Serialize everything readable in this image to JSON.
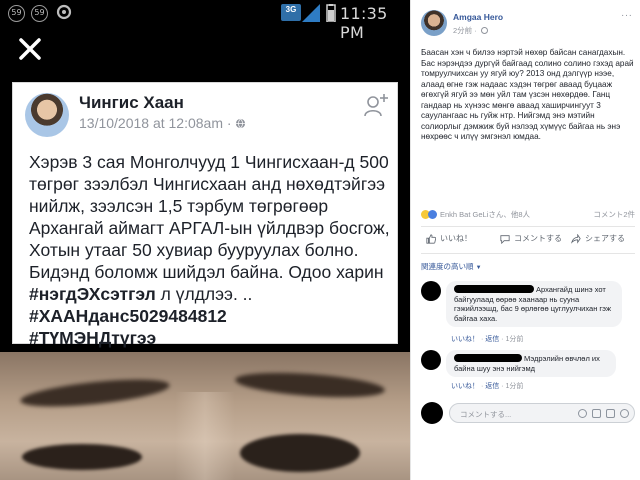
{
  "status_bar": {
    "notif_1": "59",
    "notif_2": "59",
    "network": "3G",
    "time": "11:35 PM"
  },
  "screenshot_post": {
    "author": "Чингис Хаан",
    "date": "13/10/2018 at 12:08am ·",
    "text_plain": "Хэрэв 3 сая Монголчууд 1 Чингисхаан-д 500 төгрөг зээлбэл Чингисхаан анд нөхөдтэйгээ нийлж, зээлсэн 1,5 тэрбум төгрөгөөр Архангай аймагт АРГАЛ-ын үйлдвэр босгож, Хотын утааг 50 хувиар бууруулах болно. Бидэнд боломж шийдэл байна. Одоо харин",
    "text_bold": "#нэгдЭХсэтгэл",
    "text_after": " л үлдлээ. ..",
    "tag_1": "#ХААНданс5029484812",
    "tag_2": "#ТҮМЭНДтүгээ"
  },
  "post": {
    "author": "Amgaa Hero",
    "time": "2分前",
    "menu": "···",
    "body": "Баасан хэн ч билээ нэртэй нөхөр байсан санагдахын. Бас нэрэндээ дургүй байгаад солино солино гэхэд арай томруулчихсан уу ягуй юу? 2013 онд дэлгүүр нээе, алаад өгне гэж надаас хэдэн төгрөг аваад буцааж өгөхгүй ягуй ээ мөн уйл там үзсэн нөхөрдөө. Ганц гандаар нь хүнээс мөнгө аваад хаширчингуут 3 сауулангаас нь гуйж нтр. Нийгэмд энэ мэтийн солиорлыг дэмжиж буй нэлээд хүмүүс байгаа нь энэ нөхрөөс ч илүү эмгэнэл юмдаа.",
    "reactions_text": "Enkh Bat GeLiさん、他8人",
    "comments_count": "コメント2件",
    "actions": {
      "like": "いいね！",
      "comment": "コメントする",
      "share": "シェアする"
    },
    "sort_label": "関連度の高い順",
    "comments": [
      {
        "text": "Архангайд шинэ хот байгуулаад өөрөө хаанаар нь сууна гэжийлээшд, бас 9 өрлөгөө цуглуулчихан гэж байгаа хаха.",
        "like": "いいね！",
        "reply": "返信",
        "time": "1分前"
      },
      {
        "text": "Мэдрэлийн өвчлөл их байна шуу энэ нийгэмд",
        "like": "いいね！",
        "reply": "返信",
        "time": "1分前"
      }
    ],
    "compose_placeholder": "コメントする..."
  },
  "colors": {
    "link_blue": "#365899",
    "muted": "#90949c",
    "bubble": "#f2f3f5"
  }
}
